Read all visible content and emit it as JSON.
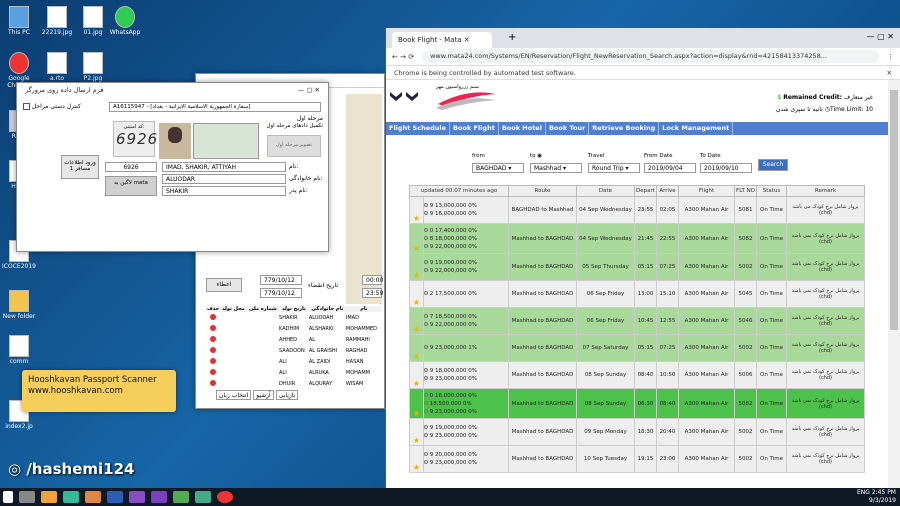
{
  "desktop": {
    "icons": [
      "This PC",
      "22219.jpg",
      "01.jpg",
      "WhatsApp",
      "Google Chrome",
      "a.rto",
      "P2.jpg",
      "Recy",
      "HKnc",
      "ICOCE2019",
      "New folder",
      "comm",
      "ahcu",
      "index2.jp"
    ]
  },
  "scanner_window": {
    "title": "فرم ارسال داده روی مرورگر",
    "passport_line": "A16115947 - [سفارة الجمهورية الاسلامية الايرانية - بغداد]",
    "checkbox_label": "کنترل دستی مراحل",
    "code_label": "کد امنیتی:",
    "captcha": "6926",
    "captcha_input": "6926",
    "stage_label": "مرحله اول",
    "stage_desc": "تکمیل دادهای مرحله اول",
    "name_label": "نام:",
    "name_value": "IMAD, SHAKIR, ATTIYAH",
    "family_label": "نام خانوادگی:",
    "family_value": "ALUODAR",
    "father_label": "نام پدر:",
    "father_value": "SHAKIR",
    "login_btn": "لاگین به mata",
    "enter_btn": "ورود اطلاعات مسافر 1",
    "photo_caption": "تصویر مرحله اول"
  },
  "back_window": {
    "dates": [
      "779/10/12",
      "779/10/12"
    ],
    "times": [
      "00:00",
      "23:59"
    ],
    "print_label": "تاریخ انقضاء",
    "ok_label": "اعطاء",
    "table_headers": [
      "حذف",
      "محل تولد",
      "شماره ملی",
      "تاریخ تولد",
      "نام خانوادگی",
      "نام"
    ],
    "rows": [
      [
        "SHAKIR",
        "ALUODAH",
        "IMAD"
      ],
      [
        "KADHIM",
        "ALSHARKI",
        "MOHAMMED"
      ],
      [
        "AHHED",
        "AL",
        "RAMMAHI"
      ],
      [
        "SAADOON",
        "AL GRAISHI",
        "RAGHAD"
      ],
      [
        "ALI",
        "AL ZAIDI",
        "HASAN"
      ],
      [
        "ALI",
        "ALRUKA",
        "MOHAMM"
      ],
      [
        "DHUIR",
        "ALQURAY",
        "WISAM"
      ]
    ],
    "footer_tabs": [
      "بازیابی",
      "آرشیو",
      "انتخاب زبان"
    ]
  },
  "chrome": {
    "tab_title": "Book Flight - Mata",
    "url": "www.mata24.com/Systems/EN/Reservation/Flight_NewReservation_Search.aspx?action=display&rnd=42158413374258...",
    "infobar": "Chrome is being controlled by automated test software."
  },
  "site": {
    "remained_label": "Remained Credit:",
    "remained_value": "غير متعارف",
    "time_limit": "Time Limit: 10",
    "time_limit_tail": "ثانیه تا سپری شدن",
    "logo_text": "ستم رزرواسیون مهر",
    "menu": [
      "Flight Schedule",
      "Book Flight",
      "Book Hotel",
      "Book Tour",
      "Retrieve Booking",
      "Lock Management"
    ],
    "search": {
      "from_label": "from",
      "from_value": "BAGHDAD",
      "to_label": "to",
      "to_value": "Mashhad",
      "travel_label": "Travel",
      "travel_value": "Round Trip",
      "from_date_label": "From Date",
      "from_date": "2019/09/04",
      "to_date_label": "To Date",
      "to_date": "2019/09/10",
      "search_btn": "Search"
    },
    "updated": "updated 00:07 minutes ago",
    "headers": [
      "",
      "Price",
      "Route",
      "Date",
      "Depart",
      "Arrive",
      "Flight",
      "FLT NO",
      "Status",
      "Remark"
    ],
    "flights": [
      {
        "cls": "w",
        "prices": [
          "9 13,000,000  0%",
          "9 16,000,000  0%"
        ],
        "route": "BAGHDAD to Mashhad",
        "date": "04 Sep Wednesday",
        "dep": "23:55",
        "arr": "02:05",
        "flight": "A300 Mahan Air",
        "no": "5081",
        "status": "On Time",
        "remark": "پرواز شامل نرخ کودک می باشد (chd)"
      },
      {
        "cls": "g",
        "prices": [
          "0 17,400,000  0%",
          "8 18,000,000  0%",
          "9 22,000,000  0%"
        ],
        "route": "Mashhad to BAGHDAD",
        "date": "04 Sep Wednesday",
        "dep": "21:45",
        "arr": "22:55",
        "flight": "A300 Mahan Air",
        "no": "5082",
        "status": "On Time",
        "remark": "پرواز شامل نرخ کودک نمی باشد (chd)"
      },
      {
        "cls": "g",
        "prices": [
          "9 19,000,000  0%",
          "9 22,000,000  0%"
        ],
        "route": "Mashhad to BAGHDAD",
        "date": "05 Sep Thursday",
        "dep": "05:15",
        "arr": "07:25",
        "flight": "A300 Mahan Air",
        "no": "5002",
        "status": "On Time",
        "remark": "پرواز شامل نرخ کودک نمی باشد (chd)"
      },
      {
        "cls": "w",
        "prices": [
          "2 17,500,000  0%"
        ],
        "route": "Mashhad to BAGHDAD",
        "date": "06 Sep Friday",
        "dep": "13:00",
        "arr": "15:10",
        "flight": "A300 Mahan Air",
        "no": "5045",
        "status": "On Time",
        "remark": "پرواز شامل نرخ کودک نمی باشد (chd)"
      },
      {
        "cls": "g",
        "prices": [
          "7 18,500,000  0%",
          "9 22,000,000  0%"
        ],
        "route": "Mashhad to BAGHDAD",
        "date": "06 Sep Friday",
        "dep": "10:45",
        "arr": "12:55",
        "flight": "A300 Mahan Air",
        "no": "5046",
        "status": "On Time",
        "remark": "پرواز شامل نرخ کودک نمی باشد (chd)"
      },
      {
        "cls": "g",
        "prices": [
          "9 23,000,000  1%"
        ],
        "route": "Mashhad to BAGHDAD",
        "date": "07 Sep Saturday",
        "dep": "05:15",
        "arr": "07:25",
        "flight": "A300 Mahan Air",
        "no": "5002",
        "status": "On Time",
        "remark": "پرواز شامل نرخ کودک نمی باشد (chd)"
      },
      {
        "cls": "w",
        "prices": [
          "9 18,000,000  0%",
          "9 23,000,000  0%"
        ],
        "route": "Mashhad to BAGHDAD",
        "date": "08 Sep Sunday",
        "dep": "08:40",
        "arr": "10:50",
        "flight": "A300 Mahan Air",
        "no": "5006",
        "status": "On Time",
        "remark": "پرواز شامل نرخ کودک نمی باشد (chd)"
      },
      {
        "cls": "sel",
        "prices": [
          "0 18,000,000  0%",
          "18,500,000  0%",
          "9 23,000,000  0%"
        ],
        "route": "Mashhad to BAGHDAD",
        "date": "08 Sep Sunday",
        "dep": "06:30",
        "arr": "08:40",
        "flight": "A300 Mahan Air",
        "no": "5082",
        "status": "On Time",
        "remark": "پرواز شامل نرخ کودک نمی باشد (chd)"
      },
      {
        "cls": "w",
        "prices": [
          "9 19,000,000  0%",
          "9 23,000,000  0%"
        ],
        "route": "Mashhad to BAGHDAD",
        "date": "09 Sep Monday",
        "dep": "18:30",
        "arr": "20:40",
        "flight": "A300 Mahan Air",
        "no": "5002",
        "status": "On Time",
        "remark": "پرواز شامل نرخ کودک نمی باشد (chd)"
      },
      {
        "cls": "w",
        "prices": [
          "9 20,000,000  0%",
          "9 23,000,000  0%"
        ],
        "route": "Mashhad to BAGHDAD",
        "date": "10 Sep Tuesday",
        "dep": "19:15",
        "arr": "23:00",
        "flight": "A300 Mahan Air",
        "no": "5002",
        "status": "On Time",
        "remark": "پرواز شامل نرخ کودک نمی باشد (chd)"
      }
    ]
  },
  "promo": {
    "line1": "Hooshkavan Passport Scanner",
    "line2": "www.hooshkavan.com"
  },
  "watermark": "/hashemi124",
  "tray": {
    "lang": "ENG",
    "time": "2:45 PM",
    "date": "9/3/2019"
  }
}
